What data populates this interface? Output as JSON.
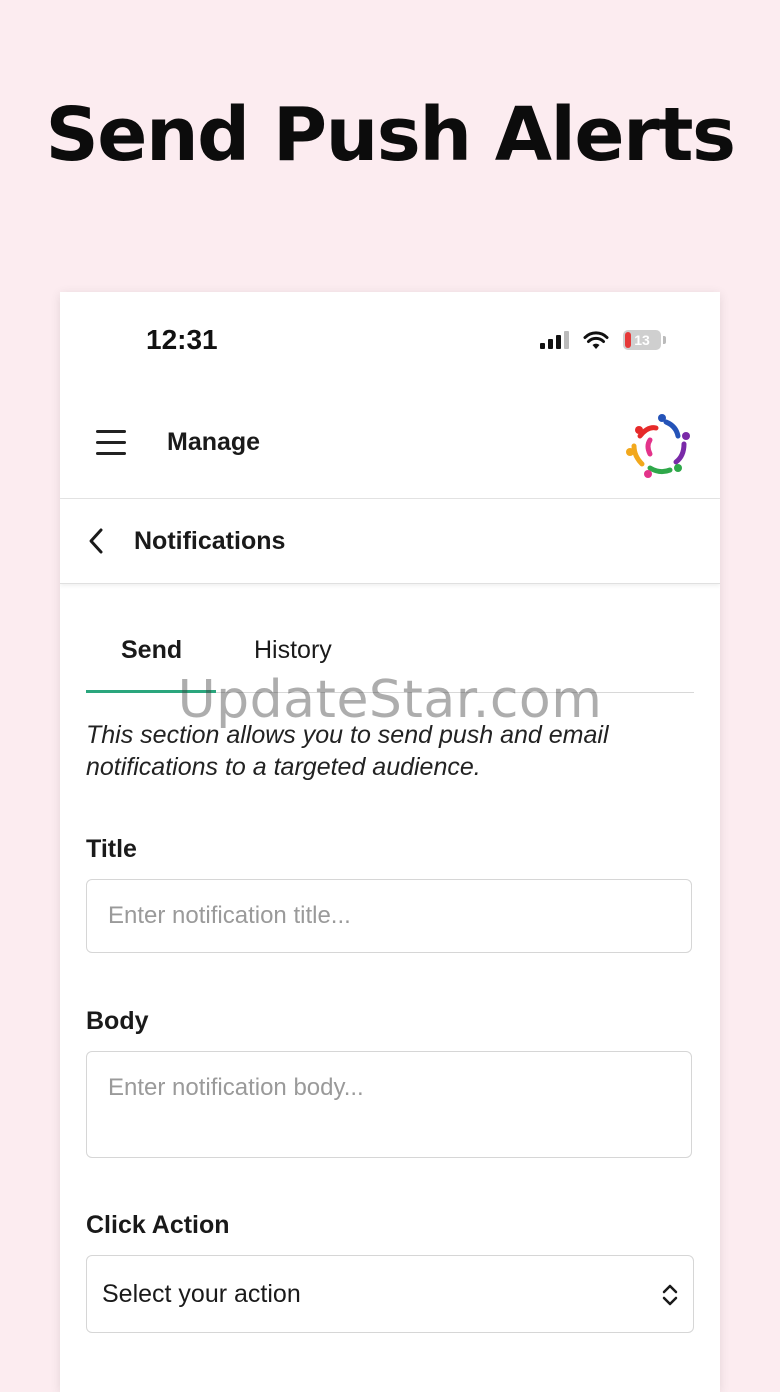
{
  "headline": "Send Push Alerts",
  "status_bar": {
    "time": "12:31",
    "battery_level": "13"
  },
  "app_bar": {
    "title": "Manage",
    "menu_icon": "hamburger-menu-icon",
    "logo": "app-logo-icon"
  },
  "sub_header": {
    "title": "Notifications",
    "back_icon": "chevron-left-icon"
  },
  "tabs": [
    {
      "label": "Send",
      "active": true
    },
    {
      "label": "History",
      "active": false
    }
  ],
  "watermark": "UpdateStar.com",
  "description": "This section allows you to send push and email notifications to a targeted audience.",
  "form": {
    "title_label": "Title",
    "title_placeholder": "Enter notification title...",
    "body_label": "Body",
    "body_placeholder": "Enter notification body...",
    "click_action_label": "Click Action",
    "click_action_value": "Select your action"
  },
  "colors": {
    "background": "#fcecf0",
    "tab_indicator": "#2aa67d",
    "battery_low": "#e63939"
  }
}
